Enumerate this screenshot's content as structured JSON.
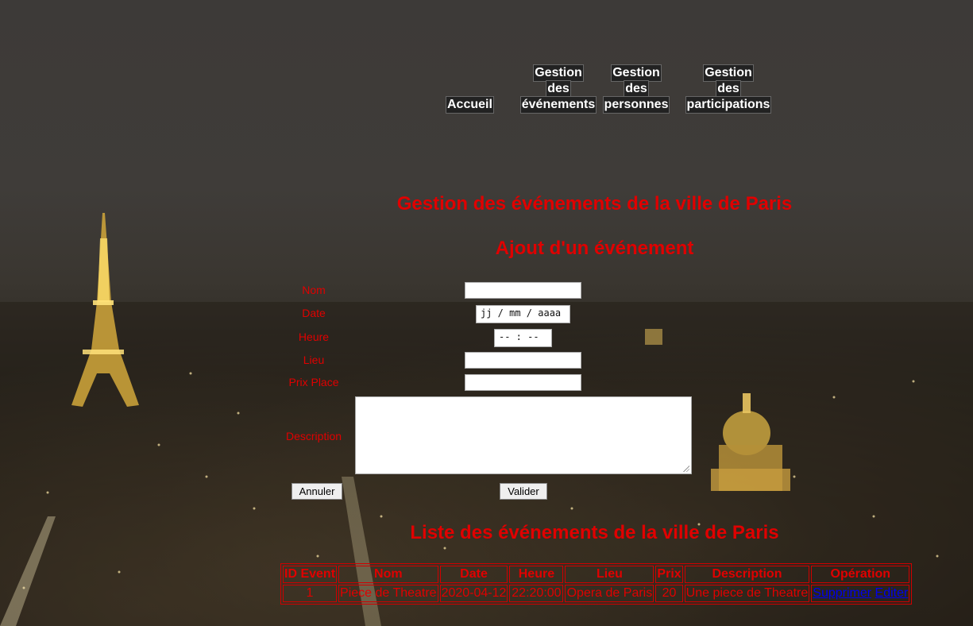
{
  "nav": {
    "items": [
      {
        "lines": [
          "Accueil"
        ]
      },
      {
        "lines": [
          "Gestion",
          "des",
          "événements"
        ]
      },
      {
        "lines": [
          "Gestion",
          "des",
          "personnes"
        ]
      },
      {
        "lines": [
          "Gestion",
          "des",
          "participations"
        ]
      }
    ]
  },
  "page": {
    "title": "Gestion des événements de la ville de Paris",
    "form_title": "Ajout d'un événement",
    "list_title": "Liste des événements de la ville de Paris"
  },
  "form": {
    "labels": {
      "nom": "Nom",
      "date": "Date",
      "heure": "Heure",
      "lieu": "Lieu",
      "prix": "Prix Place",
      "description": "Description"
    },
    "date_placeholder": "jj / mm / aaaa",
    "time_placeholder": "-- : --",
    "cancel_label": "Annuler",
    "submit_label": "Valider"
  },
  "table": {
    "headers": [
      "ID Event",
      "Nom",
      "Date",
      "Heure",
      "Lieu",
      "Prix",
      "Description",
      "Opération"
    ],
    "rows": [
      {
        "id": "1",
        "nom": "Piece de Theatre",
        "date": "2020-04-12",
        "heure": "22:20:00",
        "lieu": "Opera de Paris",
        "prix": "20",
        "description": "Une piece de Theatre",
        "delete_label": "Supprimer",
        "edit_label": "Editer"
      }
    ]
  }
}
